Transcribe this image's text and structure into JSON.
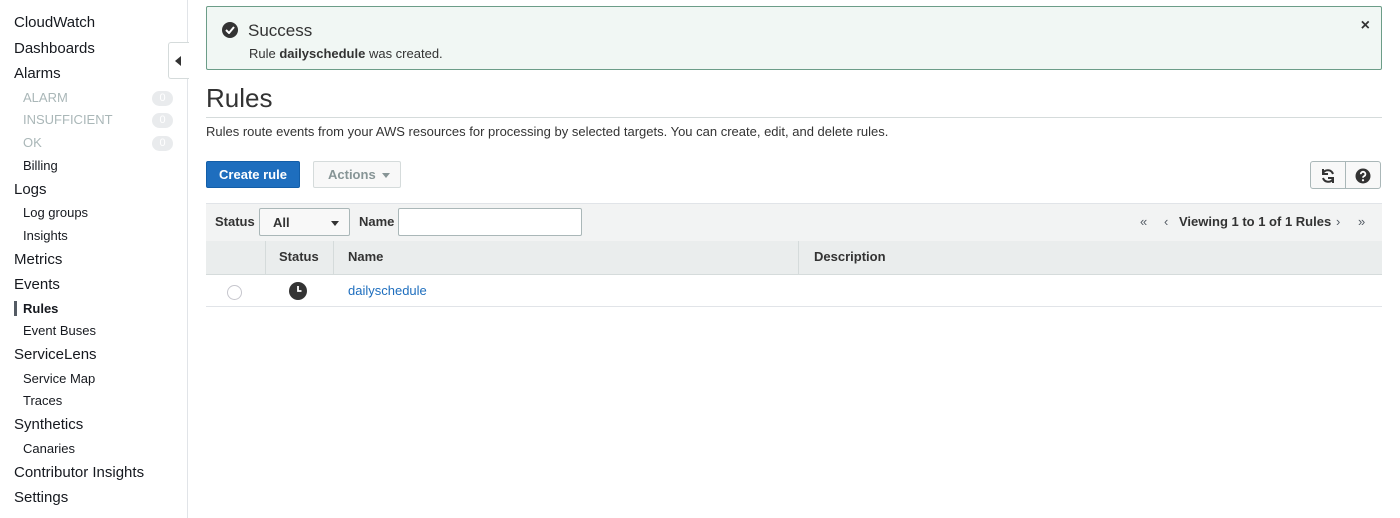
{
  "sidebar": {
    "items": [
      {
        "label": "CloudWatch"
      },
      {
        "label": "Dashboards"
      },
      {
        "label": "Alarms"
      },
      {
        "label": "ALARM",
        "count": "0"
      },
      {
        "label": "INSUFFICIENT",
        "count": "0"
      },
      {
        "label": "OK",
        "count": "0"
      },
      {
        "label": "Billing"
      },
      {
        "label": "Logs"
      },
      {
        "label": "Log groups"
      },
      {
        "label": "Insights"
      },
      {
        "label": "Metrics"
      },
      {
        "label": "Events"
      },
      {
        "label": "Rules",
        "active": true
      },
      {
        "label": "Event Buses"
      },
      {
        "label": "ServiceLens"
      },
      {
        "label": "Service Map"
      },
      {
        "label": "Traces"
      },
      {
        "label": "Synthetics"
      },
      {
        "label": "Canaries"
      },
      {
        "label": "Contributor Insights"
      },
      {
        "label": "Settings"
      }
    ]
  },
  "flash": {
    "title": "Success",
    "msg_prefix": "Rule ",
    "rule_name": "dailyschedule",
    "msg_suffix": " was created.",
    "icon": "check-circle-icon",
    "close": "×"
  },
  "page": {
    "title": "Rules",
    "description": "Rules route events from your AWS resources for processing by selected targets. You can create, edit, and delete rules."
  },
  "toolbar": {
    "create_label": "Create rule",
    "actions_label": "Actions"
  },
  "filter": {
    "status_label": "Status",
    "status_value": "All",
    "name_label": "Name",
    "name_value": "",
    "pager_text": "Viewing 1 to 1 of 1 Rules"
  },
  "table": {
    "columns": [
      "Status",
      "Name",
      "Description"
    ],
    "rows": [
      {
        "status_icon": "clock-icon",
        "name": "dailyschedule",
        "description": ""
      }
    ]
  },
  "colors": {
    "primary": "#1e6ebe",
    "success_border": "#6c9d88",
    "link": "#1e6ebe"
  }
}
